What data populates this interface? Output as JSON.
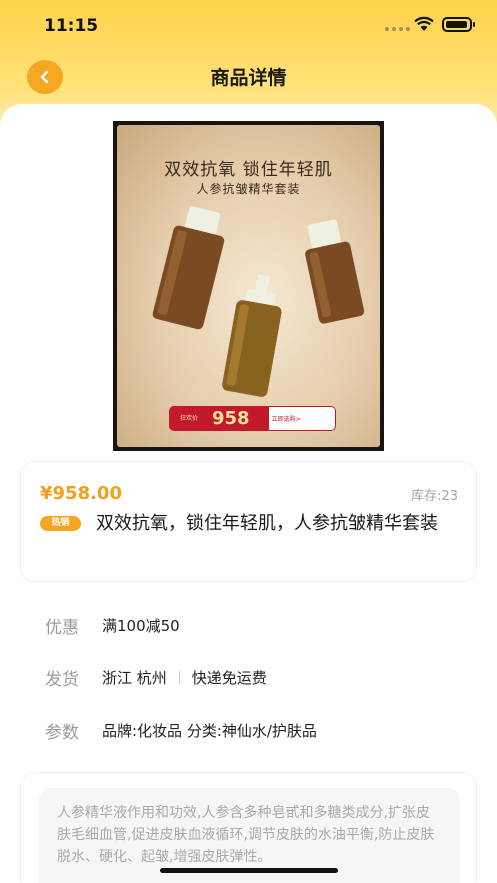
{
  "status_bar": {
    "time": "11:15"
  },
  "header": {
    "title": "商品详情"
  },
  "product": {
    "poster": {
      "headline": "双效抗氧  锁住年轻肌",
      "subline": "人参抗皱精华套装",
      "price_symbol": "¥",
      "price_label": "狂欢价",
      "price": "958",
      "buy_label": "立即选购>"
    },
    "price": "¥958.00",
    "stock": "库存:23",
    "badge": "热销",
    "name": "双效抗氧，锁住年轻肌，人参抗皱精华套装"
  },
  "specs": {
    "discount": {
      "label": "优惠",
      "value": "满100减50"
    },
    "shipping": {
      "label": "发货",
      "origin": "浙江 杭州",
      "method": "快递免运费"
    },
    "params": {
      "label": "参数",
      "value": "品牌:化妆品 分类:神仙水/护肤品"
    }
  },
  "description": "人参精华液作用和功效,人参含多种皂甙和多糖类成分,扩张皮肤毛细血管,促进皮肤血液循环,调节皮肤的水油平衡,防止皮肤脱水、硬化、起皱,增强皮肤弹性。",
  "colors": {
    "accent": "#f5a623",
    "price": "#f0a01c",
    "header": "#ffd24a",
    "poster_red": "#c21a2b"
  }
}
